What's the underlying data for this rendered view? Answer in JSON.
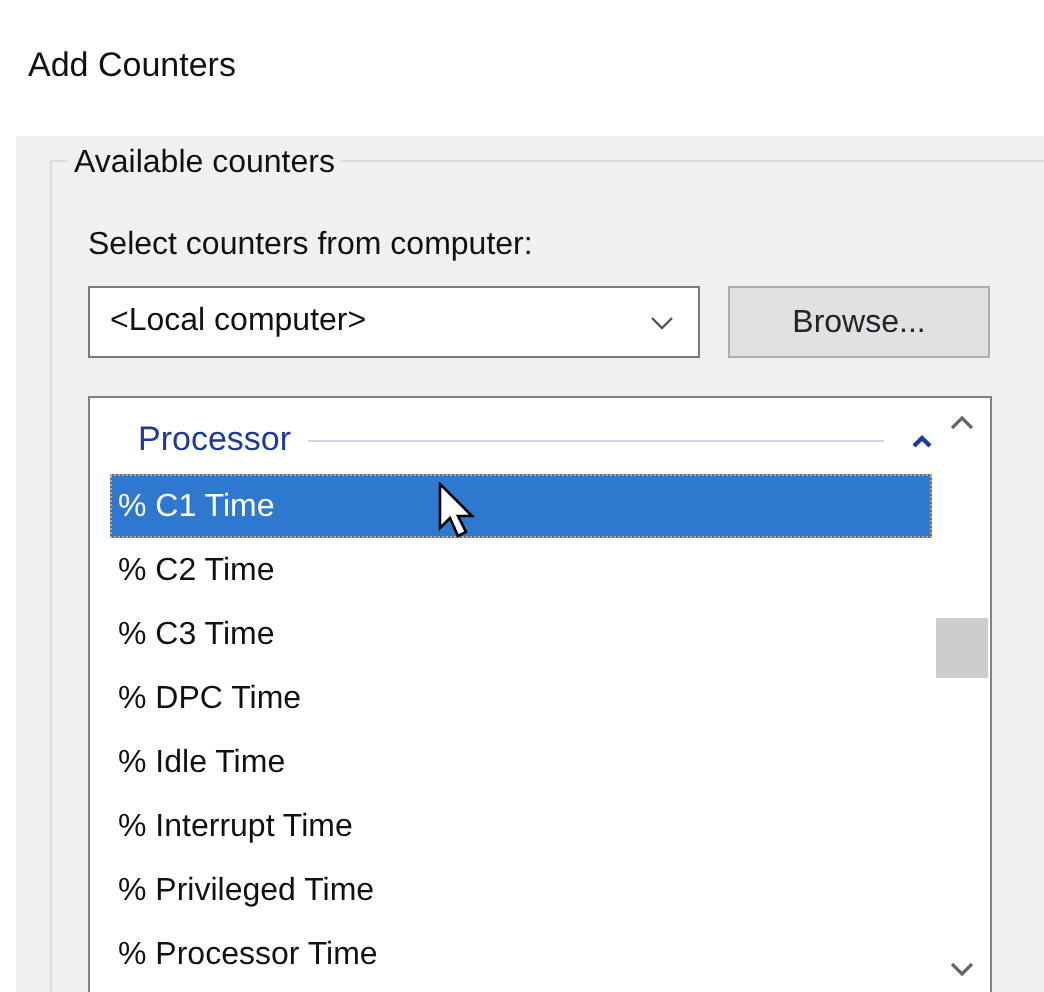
{
  "window": {
    "title": "Add Counters"
  },
  "group": {
    "legend": "Available counters"
  },
  "computer": {
    "label": "Select counters from computer:",
    "value": "<Local computer>"
  },
  "browse_button": "Browse...",
  "counters": {
    "category": "Processor",
    "expanded": true,
    "items": [
      {
        "label": "% C1 Time",
        "selected": true
      },
      {
        "label": "% C2 Time",
        "selected": false
      },
      {
        "label": "% C3 Time",
        "selected": false
      },
      {
        "label": "% DPC Time",
        "selected": false
      },
      {
        "label": "% Idle Time",
        "selected": false
      },
      {
        "label": "% Interrupt Time",
        "selected": false
      },
      {
        "label": "% Privileged Time",
        "selected": false
      },
      {
        "label": "% Processor Time",
        "selected": false
      }
    ]
  }
}
